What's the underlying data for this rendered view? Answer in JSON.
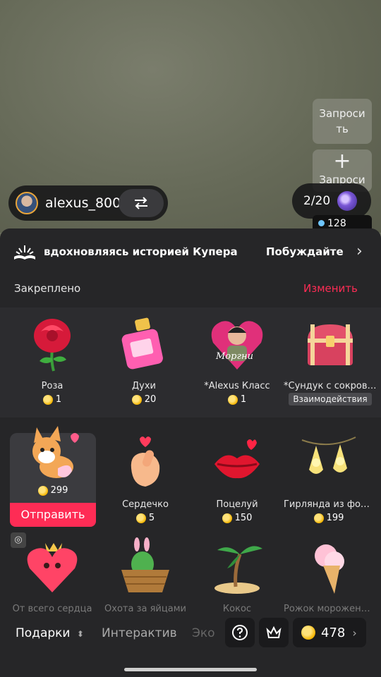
{
  "stream": {
    "request_button_label": "Запросить",
    "request_button_label2": "Запроси",
    "username": "alexus_800",
    "counter": "2/20",
    "viewer_count": "128"
  },
  "banner": {
    "text": "вдохновляясь историей Купера",
    "text2": "Побуждайте а"
  },
  "pinned": {
    "label": "Закреплено",
    "edit_label": "Изменить",
    "items": [
      {
        "name": "Роза",
        "price": "1",
        "icon": "rose-icon"
      },
      {
        "name": "Духи",
        "price": "20",
        "icon": "perfume-icon"
      },
      {
        "name": "*Alexus Класс",
        "price": "1",
        "icon": "custom-avatar-heart-icon",
        "sticker": "Моргни"
      },
      {
        "name": "*Сундук с сокровищами",
        "tag": "Взаимодействия",
        "icon": "treasure-chest-icon"
      }
    ]
  },
  "gifts": [
    {
      "name": "Корги",
      "price": "299",
      "icon": "corgi-icon",
      "selected": true
    },
    {
      "name": "Сердечко",
      "price": "5",
      "icon": "finger-heart-icon"
    },
    {
      "name": "Поцелуй",
      "price": "150",
      "icon": "kiss-lips-icon"
    },
    {
      "name": "Гирлянда из фонарей",
      "price": "199",
      "icon": "string-lights-icon"
    },
    {
      "name": "От всего сердца",
      "icon": "heart-character-icon"
    },
    {
      "name": "Охота за яйцами",
      "icon": "egg-basket-icon"
    },
    {
      "name": "Кокос",
      "icon": "palm-island-icon"
    },
    {
      "name": "Рожок мороженого",
      "icon": "ice-cream-icon"
    }
  ],
  "send_label": "Отправить",
  "tabs": {
    "gifts": "Подарки",
    "interactive": "Интерактив",
    "eco": "Эко"
  },
  "coin_balance": "478",
  "colors": {
    "accent": "#fe2c55",
    "panel": "#262628",
    "coin": "#f5b400"
  }
}
